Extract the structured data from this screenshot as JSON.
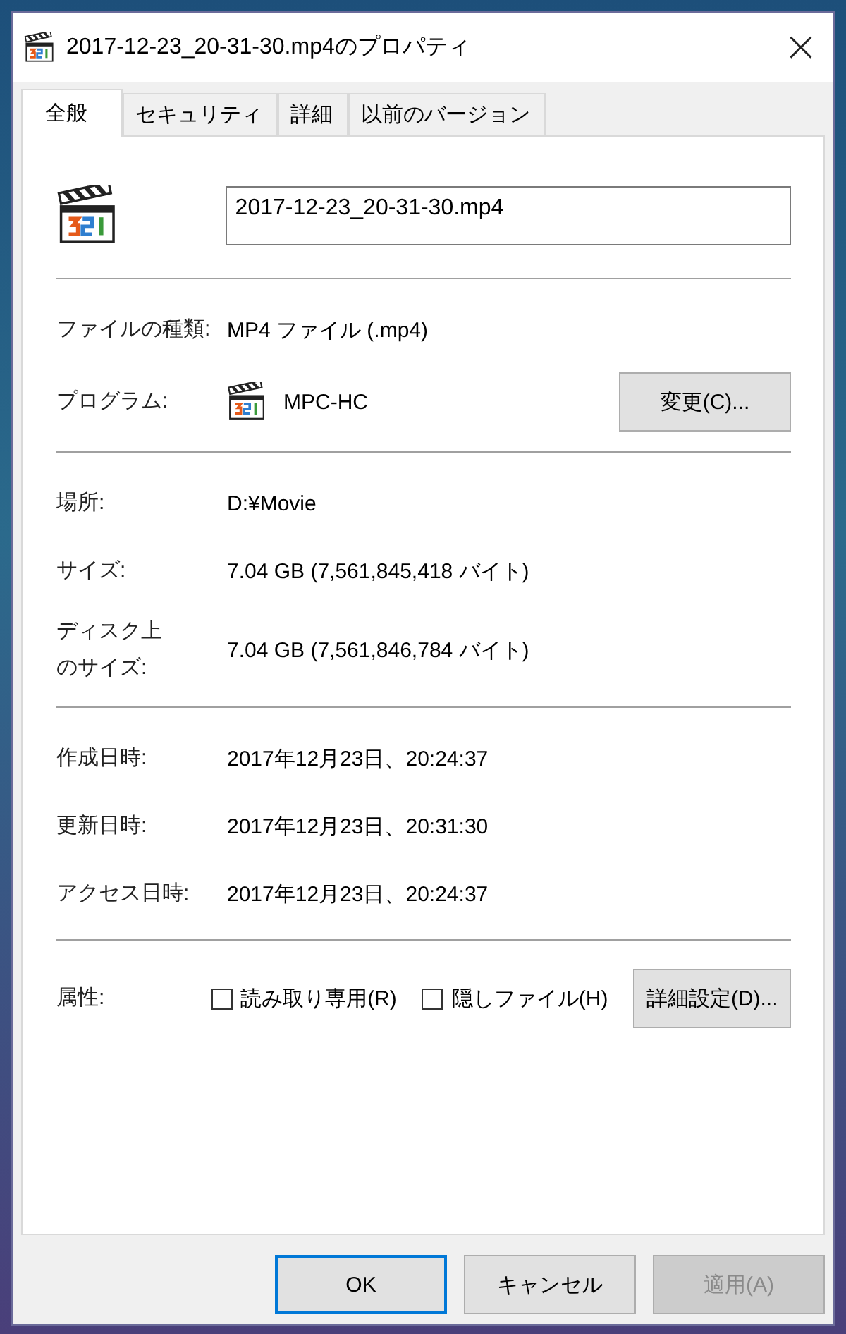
{
  "window": {
    "title": "2017-12-23_20-31-30.mp4のプロパティ",
    "close": "×"
  },
  "tabs": [
    {
      "label": "全般",
      "selected": true
    },
    {
      "label": "セキュリティ",
      "selected": false
    },
    {
      "label": "詳細",
      "selected": false
    },
    {
      "label": "以前のバージョン",
      "selected": false
    }
  ],
  "file_name": {
    "value": "2017-12-23_20-31-30.mp4"
  },
  "sections": [
    [
      {
        "kind": "text",
        "label": [
          "ファイルの種類:"
        ],
        "value": "MP4 ファイル (.mp4)"
      },
      {
        "kind": "app",
        "label": [
          "プログラム:"
        ],
        "value": "MPC-HC",
        "button": "変更(C)..."
      }
    ],
    [
      {
        "kind": "text",
        "label": [
          "場所:"
        ],
        "value": "D:¥Movie"
      },
      {
        "kind": "text",
        "label": [
          "サイズ:"
        ],
        "value": "7.04 GB (7,561,845,418 バイト)"
      },
      {
        "kind": "text",
        "label": [
          "ディスク上",
          "のサイズ:"
        ],
        "value": "7.04 GB (7,561,846,784 バイト)"
      }
    ],
    [
      {
        "kind": "text",
        "label": [
          "作成日時:"
        ],
        "value": "2017年12月23日、20:24:37"
      },
      {
        "kind": "text",
        "label": [
          "更新日時:"
        ],
        "value": "2017年12月23日、20:31:30"
      },
      {
        "kind": "text",
        "label": [
          "アクセス日時:"
        ],
        "value": "2017年12月23日、20:24:37"
      }
    ]
  ],
  "attributes": {
    "label": "属性:",
    "checkboxes": [
      {
        "label": "読み取り専用(R)",
        "checked": false
      },
      {
        "label": "隠しファイル(H)",
        "checked": false
      }
    ],
    "button": "詳細設定(D)..."
  },
  "buttons": [
    {
      "label": "OK",
      "default": true,
      "disabled": false
    },
    {
      "label": "キャンセル",
      "default": false,
      "disabled": false
    },
    {
      "label": "適用(A)",
      "default": false,
      "disabled": true
    }
  ]
}
